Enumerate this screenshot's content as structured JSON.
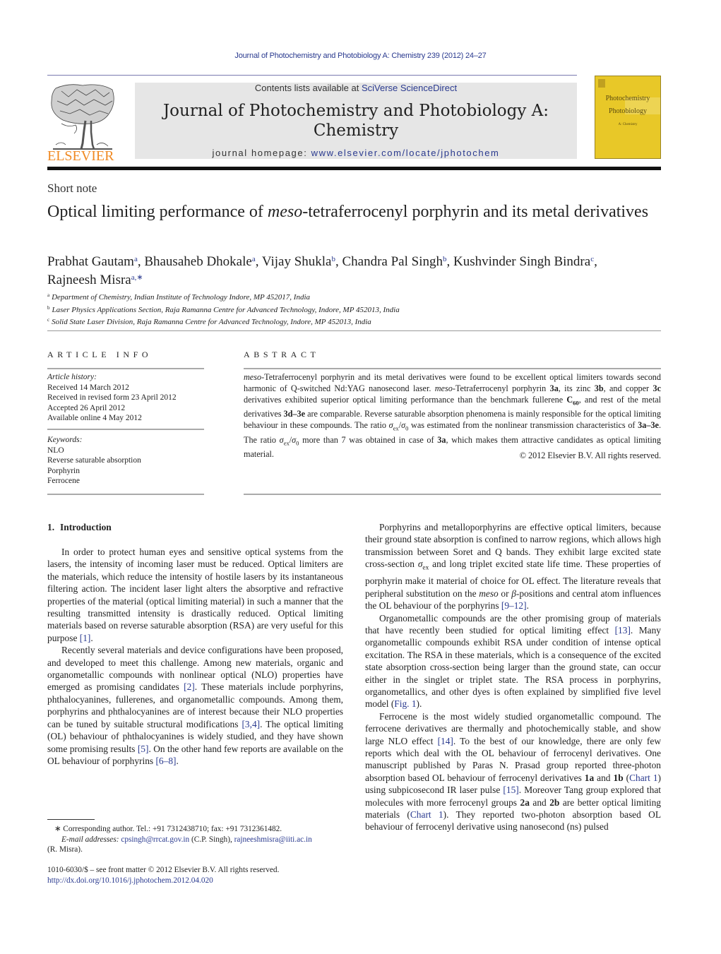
{
  "header": {
    "journal_ref": "Journal of Photochemistry and Photobiology A: Chemistry 239 (2012) 24–27",
    "contents_prefix": "Contents lists available at ",
    "contents_link": "SciVerse ScienceDirect",
    "journal_name_line1": "Journal of Photochemistry and Photobiology A:",
    "journal_name_line2": "Chemistry",
    "homepage_prefix": "journal homepage: ",
    "homepage_link": "www.elsevier.com/locate/jphotochem",
    "publisher_logo_text": "ELSEVIER",
    "cover": {
      "line1": "Photochemistry",
      "line2": "Photobiology",
      "line3": "A: Chemistry"
    },
    "colors": {
      "link": "#2a3a8f",
      "elsevier_orange": "#f08a24",
      "cover_yellow": "#e8c828",
      "banner_gray": "#e6e6e6"
    }
  },
  "article": {
    "type": "Short note",
    "title_pre": "Optical limiting performance of ",
    "title_italic": "meso",
    "title_post": "-tetraferrocenyl porphyrin and its metal derivatives",
    "authors": [
      {
        "name": "Prabhat Gautam",
        "sup": "a"
      },
      {
        "name": "Bhausaheb Dhokale",
        "sup": "a"
      },
      {
        "name": "Vijay Shukla",
        "sup": "b"
      },
      {
        "name": "Chandra Pal Singh",
        "sup": "b"
      },
      {
        "name": "Kushvinder Singh Bindra",
        "sup": "c"
      },
      {
        "name": "Rajneesh Misra",
        "sup": "a,∗"
      }
    ],
    "affiliations": [
      {
        "key": "a",
        "text": "Department of Chemistry, Indian Institute of Technology Indore, MP 452017, India"
      },
      {
        "key": "b",
        "text": "Laser Physics Applications Section, Raja Ramanna Centre for Advanced Technology, Indore, MP 452013, India"
      },
      {
        "key": "c",
        "text": "Solid State Laser Division, Raja Ramanna Centre for Advanced Technology, Indore, MP 452013, India"
      }
    ]
  },
  "article_info": {
    "heading": "ARTICLE INFO",
    "history_label": "Article history:",
    "history": [
      "Received 14 March 2012",
      "Received in revised form 23 April 2012",
      "Accepted 26 April 2012",
      "Available online 4 May 2012"
    ],
    "keywords_label": "Keywords:",
    "keywords": [
      "NLO",
      "Reverse saturable absorption",
      "Porphyrin",
      "Ferrocene"
    ]
  },
  "abstract": {
    "heading": "ABSTRACT",
    "segments": [
      {
        "t": "meso",
        "s": "i"
      },
      {
        "t": "-Tetraferrocenyl porphyrin and its metal derivatives were found to be excellent optical limiters towards second harmonic of Q-switched Nd:YAG nanosecond laser. "
      },
      {
        "t": "meso",
        "s": "i"
      },
      {
        "t": "-Tetraferrocenyl porphyrin "
      },
      {
        "t": "3a",
        "s": "b"
      },
      {
        "t": ", its zinc "
      },
      {
        "t": "3b",
        "s": "b"
      },
      {
        "t": ", and copper "
      },
      {
        "t": "3c",
        "s": "b"
      },
      {
        "t": " derivatives exhibited superior optical limiting performance than the benchmark fullerene "
      },
      {
        "t": "C",
        "s": "b"
      },
      {
        "t": "60",
        "s": "bsub"
      },
      {
        "t": ", and rest of the metal derivatives "
      },
      {
        "t": "3d–3e",
        "s": "b"
      },
      {
        "t": " are comparable. Reverse saturable absorption phenomena is mainly responsible for the optical limiting behaviour in these compounds. The ratio "
      },
      {
        "t": "σ",
        "s": "i"
      },
      {
        "t": "ex",
        "s": "sub"
      },
      {
        "t": "/"
      },
      {
        "t": "σ",
        "s": "i"
      },
      {
        "t": "0",
        "s": "sub"
      },
      {
        "t": " was estimated from the nonlinear transmission characteristics of "
      },
      {
        "t": "3a–3e",
        "s": "b"
      },
      {
        "t": ". The ratio "
      },
      {
        "t": "σ",
        "s": "i"
      },
      {
        "t": "ex",
        "s": "sub"
      },
      {
        "t": "/"
      },
      {
        "t": "σ",
        "s": "i"
      },
      {
        "t": "0",
        "s": "sub"
      },
      {
        "t": " more than 7 was obtained in case of "
      },
      {
        "t": "3a",
        "s": "b"
      },
      {
        "t": ", which makes them attractive candidates as optical limiting material."
      }
    ],
    "copyright": "© 2012 Elsevier B.V. All rights reserved."
  },
  "body": {
    "section_number": "1.",
    "section_title": "Introduction",
    "left_paragraphs": [
      [
        {
          "t": "In order to protect human eyes and sensitive optical systems from the lasers, the intensity of incoming laser must be reduced. Optical limiters are the materials, which reduce the intensity of hostile lasers by its instantaneous filtering action. The incident laser light alters the absorptive and refractive properties of the material (optical limiting material) in such a manner that the resulting transmitted intensity is drastically reduced. Optical limiting materials based on reverse saturable absorption (RSA) are very useful for this purpose "
        },
        {
          "t": "[1]",
          "s": "link"
        },
        {
          "t": "."
        }
      ],
      [
        {
          "t": "Recently several materials and device configurations have been proposed, and developed to meet this challenge. Among new materials, organic and organometallic compounds with nonlinear optical (NLO) properties have emerged as promising candidates "
        },
        {
          "t": "[2]",
          "s": "link"
        },
        {
          "t": ". These materials include porphyrins, phthalocyanines, fullerenes, and organometallic compounds. Among them, porphyrins and phthalocyanines are of interest because their NLO properties can be tuned by suitable structural modifications "
        },
        {
          "t": "[3,4]",
          "s": "link"
        },
        {
          "t": ". The optical limiting (OL) behaviour of phthalocyanines is widely studied, and they have shown some promising results "
        },
        {
          "t": "[5]",
          "s": "link"
        },
        {
          "t": ". On the other hand few reports are available on the OL behaviour of porphyrins "
        },
        {
          "t": "[6–8]",
          "s": "link"
        },
        {
          "t": "."
        }
      ]
    ],
    "right_paragraphs": [
      [
        {
          "t": "Porphyrins and metalloporphyrins are effective optical limiters, because their ground state absorption is confined to narrow regions, which allows high transmission between Soret and Q bands. They exhibit large excited state cross-section "
        },
        {
          "t": "σ",
          "s": "i"
        },
        {
          "t": "ex",
          "s": "sub"
        },
        {
          "t": " and long triplet excited state life time. These properties of porphyrin make it material of choice for OL effect. The literature reveals that peripheral substitution on the "
        },
        {
          "t": "meso",
          "s": "i"
        },
        {
          "t": " or "
        },
        {
          "t": "β",
          "s": "i"
        },
        {
          "t": "-positions and central atom influences the OL behaviour of the porphyrins "
        },
        {
          "t": "[9–12]",
          "s": "link"
        },
        {
          "t": "."
        }
      ],
      [
        {
          "t": "Organometallic compounds are the other promising group of materials that have recently been studied for optical limiting effect "
        },
        {
          "t": "[13]",
          "s": "link"
        },
        {
          "t": ". Many organometallic compounds exhibit RSA under condition of intense optical excitation. The RSA in these materials, which is a consequence of the excited state absorption cross-section being larger than the ground state, can occur either in the singlet or triplet state. The RSA process in porphyrins, organometallics, and other dyes is often explained by simplified five level model ("
        },
        {
          "t": "Fig. 1",
          "s": "link"
        },
        {
          "t": ")."
        }
      ],
      [
        {
          "t": "Ferrocene is the most widely studied organometallic compound. The ferrocene derivatives are thermally and photochemically stable, and show large NLO effect "
        },
        {
          "t": "[14]",
          "s": "link"
        },
        {
          "t": ". To the best of our knowledge, there are only few reports which deal with the OL behaviour of ferrocenyl derivatives. One manuscript published by Paras N. Prasad group reported three-photon absorption based OL behaviour of ferrocenyl derivatives "
        },
        {
          "t": "1a",
          "s": "b"
        },
        {
          "t": " and "
        },
        {
          "t": "1b",
          "s": "b"
        },
        {
          "t": " ("
        },
        {
          "t": "Chart 1",
          "s": "link"
        },
        {
          "t": ") using subpicosecond IR laser pulse "
        },
        {
          "t": "[15]",
          "s": "link"
        },
        {
          "t": ". Moreover Tang group explored that molecules with more ferrocenyl groups "
        },
        {
          "t": "2a",
          "s": "b"
        },
        {
          "t": " and "
        },
        {
          "t": "2b",
          "s": "b"
        },
        {
          "t": " are better optical limiting materials ("
        },
        {
          "t": "Chart 1",
          "s": "link"
        },
        {
          "t": "). They reported two-photon absorption based OL behaviour of ferrocenyl derivative using nanosecond (ns) pulsed"
        }
      ]
    ]
  },
  "footnotes": {
    "marker": "∗",
    "corresponding": "Corresponding author. Tel.: +91 7312438710; fax: +91 7312361482.",
    "email_label": "E-mail addresses:",
    "email1": "cpsingh@rrcat.gov.in",
    "email1_name": " (C.P. Singh), ",
    "email2": "rajneeshmisra@iiti.ac.in",
    "email2_name": "(R. Misra).",
    "issn": "1010-6030/$ – see front matter © 2012 Elsevier B.V. All rights reserved.",
    "doi": "http://dx.doi.org/10.1016/j.jphotochem.2012.04.020"
  }
}
